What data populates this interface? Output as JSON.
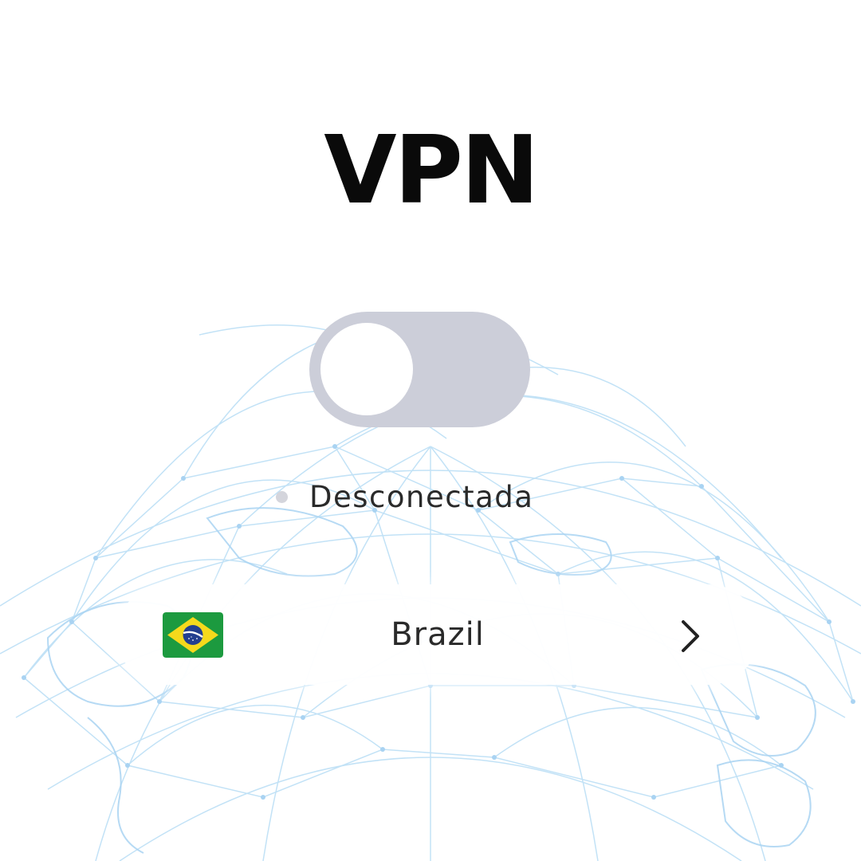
{
  "header": {
    "title": "VPN"
  },
  "connection": {
    "toggle_on": false,
    "status_text": "Desconectada"
  },
  "server": {
    "country_name": "Brazil",
    "flag_icon": "brazil-flag-icon",
    "arrow_icon": "chevron-right-icon"
  },
  "colors": {
    "title": "#0a0a0a",
    "toggle_track_off": "#ccced9",
    "toggle_knob": "#ffffff",
    "status_dot": "#d4d5dc",
    "text": "#2a2a2a",
    "map_lines": "#b9dcf5"
  }
}
